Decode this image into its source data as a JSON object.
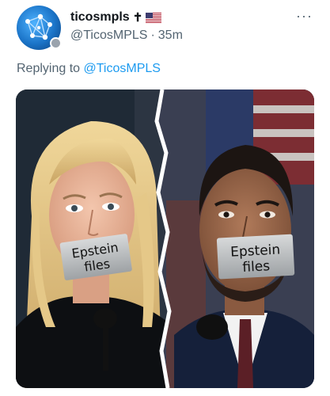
{
  "tweet": {
    "display_name": "ticosmpls",
    "cross_glyph": "✝",
    "flag_icon": "us-flag-icon",
    "handle": "@TicosMPLS",
    "separator": "·",
    "timestamp": "35m",
    "more_label": "···",
    "replying_prefix": "Replying to",
    "replying_handle": "@TicosMPLS"
  },
  "media": {
    "left_tape": {
      "line1": "Epstein",
      "line2": "files"
    },
    "right_tape": {
      "line1": "Epstein",
      "line2": "files"
    }
  }
}
